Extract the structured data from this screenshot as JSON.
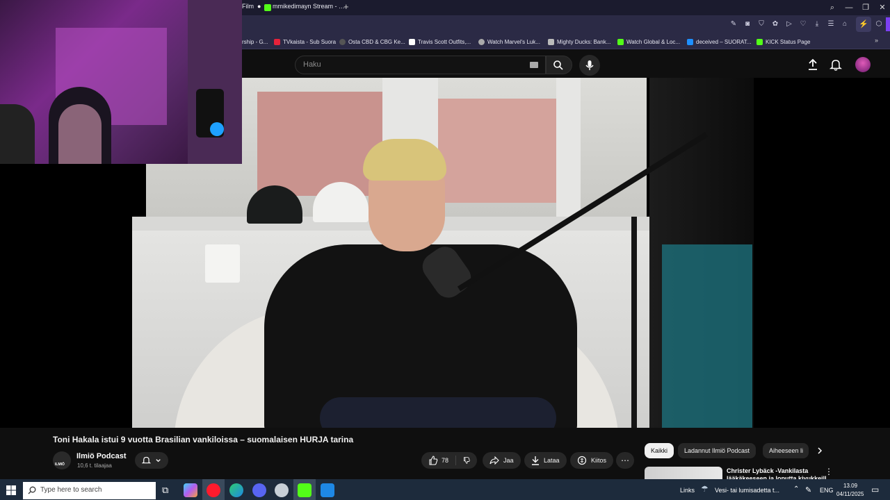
{
  "browser": {
    "tabs": [
      {
        "label": "Film"
      },
      {
        "label": "mmikedimayn Stream - …"
      }
    ],
    "bookmarks": [
      {
        "label": "rship - G..."
      },
      {
        "label": "TVkaista - Sub Suora"
      },
      {
        "label": "Osta CBD & CBG Ke..."
      },
      {
        "label": "Travis Scott Outfits,..."
      },
      {
        "label": "Watch Marvel's Luk..."
      },
      {
        "label": "Mighty Ducks: Bank..."
      },
      {
        "label": "Watch Global & Loc..."
      },
      {
        "label": "deceived – SUORAT..."
      },
      {
        "label": "KICK Status Page"
      }
    ]
  },
  "youtube": {
    "search_placeholder": "Haku",
    "video_title": "Toni Hakala istui 9 vuotta Brasilian vankiloissa – suomalaisen HURJA tarina",
    "channel": {
      "name": "Ilmiö Podcast",
      "subscribers": "10,6 t. tilaajaa",
      "logo_text": "ILMIÖ"
    },
    "actions": {
      "likes": "78",
      "share": "Jaa",
      "download": "Lataa",
      "thanks": "Kiitos"
    },
    "chips": [
      "Kaikki",
      "Ladannut Ilmiö Podcast",
      "Aiheeseen li"
    ],
    "related": {
      "title_line1": "Christer Lybäck -Vankilasta",
      "title_line2": "lääkäkeeseen ja loputta kivukkeill..."
    }
  },
  "taskbar": {
    "search_placeholder": "Type here to search",
    "links_label": "Links",
    "weather": "Vesi- tai lumisadetta t...",
    "language": "ENG",
    "time": "13.09",
    "date": "04/11/2025"
  },
  "colors": {
    "yt_bg": "#0f0f0f",
    "taskbar": "#1d2b3c",
    "tabstrip": "#1b1b2e",
    "toolbar": "#2b2a45"
  }
}
